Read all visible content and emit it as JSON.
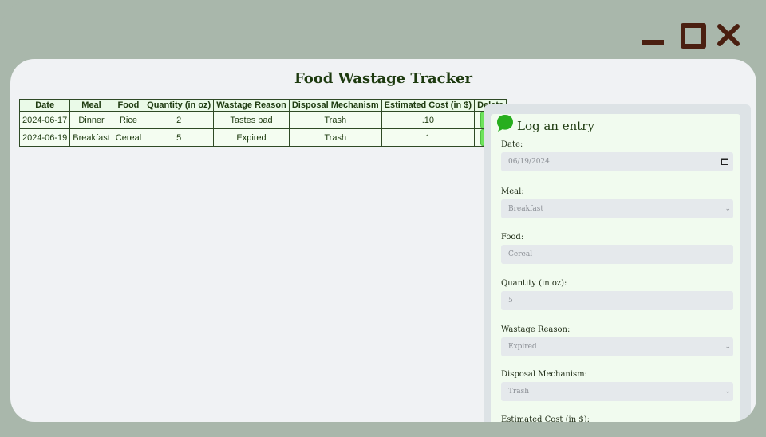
{
  "window": {
    "minimize_icon": "minimize-icon",
    "maximize_icon": "maximize-icon",
    "close_icon": "close-icon"
  },
  "title": "Food Wastage Tracker",
  "table": {
    "headers": [
      "Date",
      "Meal",
      "Food",
      "Quantity (in oz)",
      "Wastage Reason",
      "Disposal Mechanism",
      "Estimated Cost (in $)",
      "Delete"
    ],
    "rows": [
      {
        "date": "2024-06-17",
        "meal": "Dinner",
        "food": "Rice",
        "quantity": "2",
        "reason": "Tastes bad",
        "disposal": "Trash",
        "cost": ".10",
        "delete": "x"
      },
      {
        "date": "2024-06-19",
        "meal": "Breakfast",
        "food": "Cereal",
        "quantity": "5",
        "reason": "Expired",
        "disposal": "Trash",
        "cost": "1",
        "delete": "x"
      }
    ]
  },
  "form": {
    "title": "Log an entry",
    "icon": "chat-bubble-icon",
    "date_label": "Date:",
    "date_value": "06/19/2024",
    "meal_label": "Meal:",
    "meal_value": "Breakfast",
    "food_label": "Food:",
    "food_value": "Cereal",
    "quantity_label": "Quantity (in oz):",
    "quantity_value": "5",
    "reason_label": "Wastage Reason:",
    "reason_value": "Expired",
    "disposal_label": "Disposal Mechanism:",
    "disposal_value": "Trash",
    "cost_label": "Estimated Cost (in $):"
  },
  "colors": {
    "outer_bg": "#a9b7ab",
    "page_bg": "#f0f2f4",
    "accent_dark": "#4a1f10",
    "title_green": "#1d3a0f",
    "delete_green": "#6ee35c"
  }
}
